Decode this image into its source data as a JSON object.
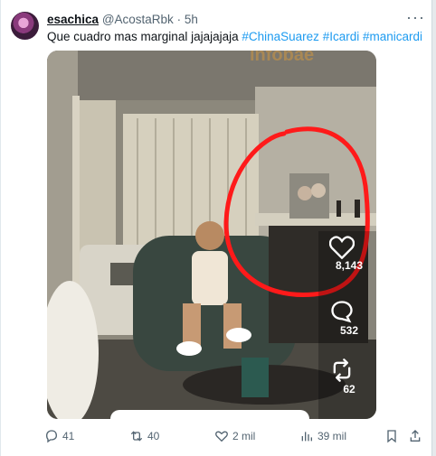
{
  "tweet": {
    "display_name": "esachica",
    "handle": "@AcostaRbk",
    "time": "5h",
    "text_plain": "Que cuadro mas marginal jajajajaja ",
    "hashtags": [
      "#ChinaSuarez",
      "#Icardi",
      "#manicardi"
    ]
  },
  "video_overlay": {
    "watermark": "infobae",
    "likes": "8,143",
    "comments": "532",
    "shares": "62"
  },
  "actions": {
    "replies": "41",
    "retweets": "40",
    "likes": "2 mil",
    "views": "39 mil"
  },
  "colors": {
    "link": "#1d9bf0",
    "circle": "#ff1a1a"
  },
  "icons": [
    "more-icon",
    "reply-icon",
    "retweet-icon",
    "like-icon",
    "views-icon",
    "bookmark-icon",
    "share-icon",
    "heart-icon",
    "comment-icon",
    "share-arrows-icon"
  ]
}
